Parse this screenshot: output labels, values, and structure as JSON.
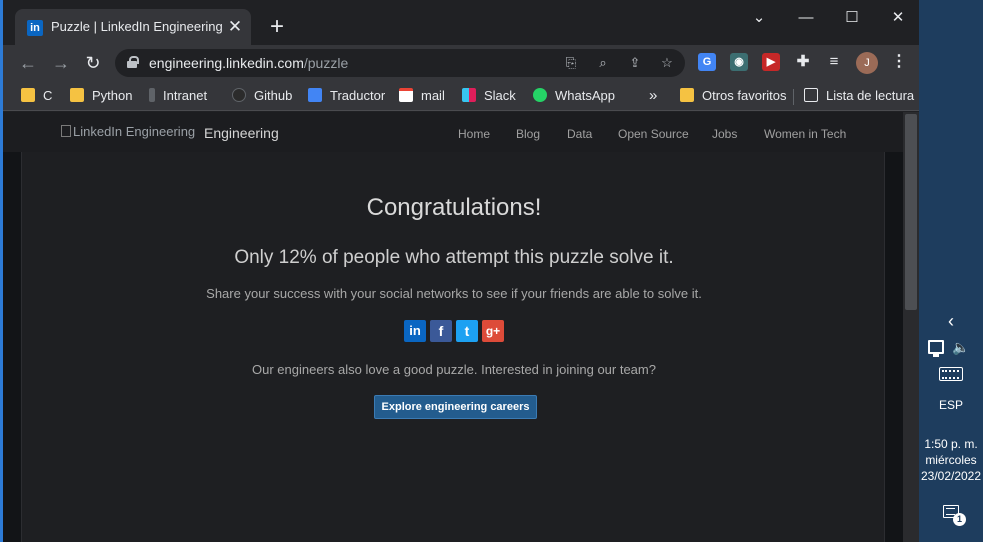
{
  "tab": {
    "title": "Puzzle | LinkedIn Engineering",
    "favicon_text": "in",
    "close_glyph": "✕"
  },
  "new_tab_glyph": "+",
  "window_controls": {
    "minimize": "—",
    "maximize": "☐",
    "close": "✕",
    "dropdown": "⌄"
  },
  "address": {
    "host": "engineering.linkedin.com",
    "path": "/puzzle"
  },
  "bookmarks": [
    {
      "label": "C",
      "icon": "folder"
    },
    {
      "label": "Python",
      "icon": "folder"
    },
    {
      "label": "Intranet",
      "icon": "intranet-icon"
    },
    {
      "label": "Github",
      "icon": "github-icon"
    },
    {
      "label": "Traductor",
      "icon": "translate-icon"
    },
    {
      "label": "mail",
      "icon": "gmail-icon"
    },
    {
      "label": "Slack",
      "icon": "slack-icon"
    },
    {
      "label": "WhatsApp",
      "icon": "whatsapp-icon"
    }
  ],
  "bookmarks_overflow": "»",
  "bookmarks_right": {
    "other": "Otros favoritos",
    "reading_list": "Lista de lectura"
  },
  "avatar_initial": "J",
  "site": {
    "logo_alt": "LinkedIn Engineering",
    "brand": "Engineering",
    "nav": [
      "Home",
      "Blog",
      "Data",
      "Open Source",
      "Jobs",
      "Women in Tech"
    ]
  },
  "content": {
    "heading": "Congratulations!",
    "stat": "Only 12% of people who attempt this puzzle solve it.",
    "share": "Share your success with your social networks to see if your friends are able to solve it.",
    "socials": [
      {
        "name": "linkedin",
        "glyph": "in",
        "color": "#0a66c2"
      },
      {
        "name": "facebook",
        "glyph": "f",
        "color": "#3b5998"
      },
      {
        "name": "twitter",
        "glyph": "t",
        "color": "#1da1f2"
      },
      {
        "name": "google-plus",
        "glyph": "g+",
        "color": "#dd4b39"
      }
    ],
    "engineers": "Our engineers also love a good puzzle. Interested in joining our team?",
    "cta": "Explore engineering careers"
  },
  "taskbar": {
    "chevron": "‹",
    "language": "ESP",
    "time": "1:50 p. m.",
    "weekday": "miércoles",
    "date": "23/02/2022",
    "notification_count": "1"
  }
}
